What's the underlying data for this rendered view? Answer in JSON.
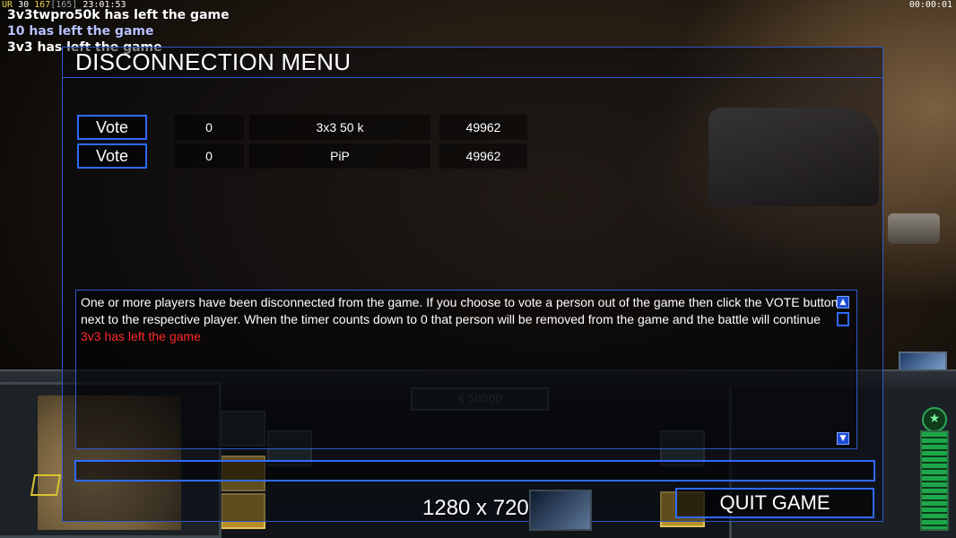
{
  "overlay": {
    "stats_ur": "UR",
    "stats_fps": "30",
    "stats_a": "167",
    "stats_b": "[165]",
    "stats_time": "23:01:53",
    "clock": "00:00:01",
    "feed": [
      {
        "text": "3v3twpro50k has left the game",
        "color": "#ffffff"
      },
      {
        "text": "10 has left the game",
        "color": "#b9c2ff"
      },
      {
        "text": "3v3 has left the game",
        "color": "#ffffff"
      }
    ]
  },
  "dialog": {
    "title": "DISCONNECTION MENU",
    "players": [
      {
        "vote_label": "Vote",
        "slot": "0",
        "name": "3x3 50 k",
        "cash": "49962"
      },
      {
        "vote_label": "Vote",
        "slot": "0",
        "name": "PiP",
        "cash": "49962"
      }
    ],
    "message": "One or more players have been disconnected from the game. If you choose to vote a person out of the game then click the VOTE button next to the respective player. When the timer counts down to 0 that person will be removed from the game and the battle will continue",
    "alert": "3v3 has left the game",
    "chat_value": "",
    "quit_label": "QUIT GAME"
  },
  "hud": {
    "money": "$ 50000",
    "resolution": "1280 x 720"
  },
  "icons": {
    "scroll_up": "triangle-up",
    "scroll_down": "triangle-down",
    "power": "star-emblem"
  },
  "colors": {
    "accent_border": "#2f6bff",
    "alert_text": "#ff2a2a"
  }
}
